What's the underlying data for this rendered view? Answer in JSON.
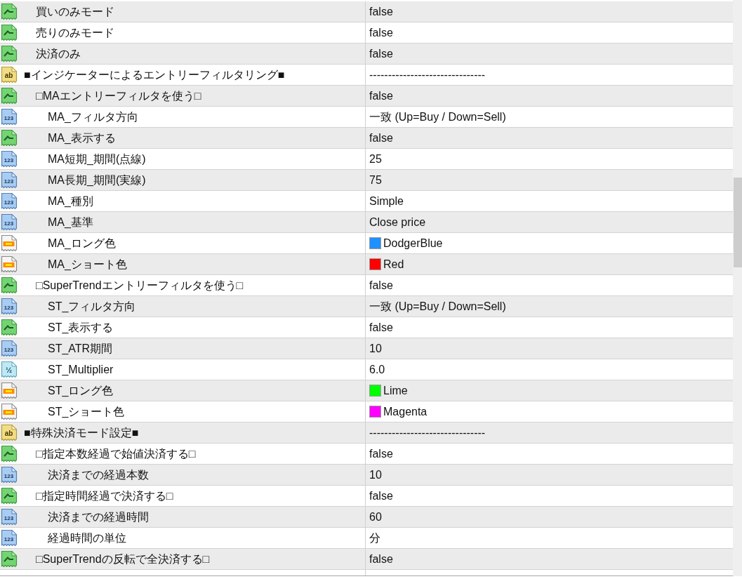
{
  "sections": [
    {
      "items": [
        {
          "kind": "bool",
          "name": "買いのみモード",
          "value": "false"
        },
        {
          "kind": "bool",
          "name": "売りのみモード",
          "value": "false"
        },
        {
          "kind": "bool",
          "name": "決済のみ",
          "value": "false"
        }
      ]
    },
    {
      "header": {
        "kind": "string",
        "icon_label": "ab",
        "name": "■インジケーターによるエントリーフィルタリング■",
        "value": "-------------------------------"
      },
      "items": [
        {
          "kind": "bool",
          "name": "□MAエントリーフィルタを使う□",
          "value": "false",
          "children": [
            {
              "kind": "int",
              "icon_label": "123",
              "name": "MA_フィルタ方向",
              "value": "一致 (Up=Buy / Down=Sell)"
            },
            {
              "kind": "bool",
              "name": "MA_表示する",
              "value": "false"
            },
            {
              "kind": "int",
              "icon_label": "123",
              "name": "MA短期_期間(点線)",
              "value": "25"
            },
            {
              "kind": "int",
              "icon_label": "123",
              "name": "MA長期_期間(実線)",
              "value": "75"
            },
            {
              "kind": "int",
              "icon_label": "123",
              "name": "MA_種別",
              "value": "Simple"
            },
            {
              "kind": "int",
              "icon_label": "123",
              "name": "MA_基準",
              "value": "Close price"
            },
            {
              "kind": "color",
              "name": "MA_ロング色",
              "value": "DodgerBlue",
              "color": "#1e90ff"
            },
            {
              "kind": "color",
              "name": "MA_ショート色",
              "value": "Red",
              "color": "#ff0000"
            }
          ]
        },
        {
          "kind": "bool",
          "name": "□SuperTrendエントリーフィルタを使う□",
          "value": "false",
          "children": [
            {
              "kind": "int",
              "icon_label": "123",
              "name": "ST_フィルタ方向",
              "value": "一致 (Up=Buy / Down=Sell)"
            },
            {
              "kind": "bool",
              "name": "ST_表示する",
              "value": "false"
            },
            {
              "kind": "int",
              "icon_label": "123",
              "name": "ST_ATR期間",
              "value": "10"
            },
            {
              "kind": "double",
              "icon_label": "½",
              "name": "ST_Multiplier",
              "value": "6.0"
            },
            {
              "kind": "color",
              "name": "ST_ロング色",
              "value": "Lime",
              "color": "#00ff00"
            },
            {
              "kind": "color",
              "name": "ST_ショート色",
              "value": "Magenta",
              "color": "#ff00ff"
            }
          ]
        }
      ]
    },
    {
      "header": {
        "kind": "string",
        "icon_label": "ab",
        "name": "■特殊決済モード設定■",
        "value": "-------------------------------"
      },
      "items": [
        {
          "kind": "bool",
          "name": "□指定本数経過で始値決済する□",
          "value": "false",
          "children": [
            {
              "kind": "int",
              "icon_label": "123",
              "name": "決済までの経過本数",
              "value": "10"
            }
          ]
        },
        {
          "kind": "bool",
          "name": "□指定時間経過で決済する□",
          "value": "false",
          "children": [
            {
              "kind": "int",
              "icon_label": "123",
              "name": "決済までの経過時間",
              "value": "60"
            },
            {
              "kind": "int",
              "icon_label": "123",
              "name": "経過時間の単位",
              "value": "分"
            }
          ]
        },
        {
          "kind": "bool",
          "name": "□SuperTrendの反転で全決済する□",
          "value": "false"
        }
      ]
    }
  ]
}
